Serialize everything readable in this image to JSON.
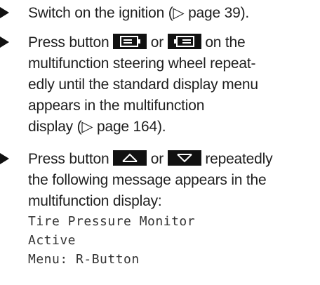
{
  "steps": [
    {
      "text_before": "Switch on the ignition (",
      "page_ref_symbol": "▷",
      "page_ref_text": " page 39).",
      "text_after": ""
    },
    {
      "press_text": "Press button ",
      "or_text": " or ",
      "line1_tail": " on the",
      "line2": "multifunction steering wheel repeat-",
      "line3": "edly until the standard display menu",
      "line4": "appears in the multifunction",
      "line5_before": "display (",
      "page_ref_symbol": "▷",
      "page_ref_text": " page 164)."
    },
    {
      "press_text": "Press button ",
      "or_text": " or ",
      "line1_tail": "  repeatedly",
      "line2": "the following message appears in the",
      "line3": "multifunction display:",
      "display_message": [
        "Tire Pressure Monitor",
        "Active",
        "Menu: R-Button"
      ]
    }
  ],
  "icons": {
    "display_left": "display-left-button-icon",
    "display_right": "display-right-button-icon",
    "arrow_up": "arrow-up-button-icon",
    "arrow_down": "arrow-down-button-icon"
  },
  "colors": {
    "text": "#1f1f1f",
    "button_bg": "#111111",
    "mono_text": "#333333"
  }
}
